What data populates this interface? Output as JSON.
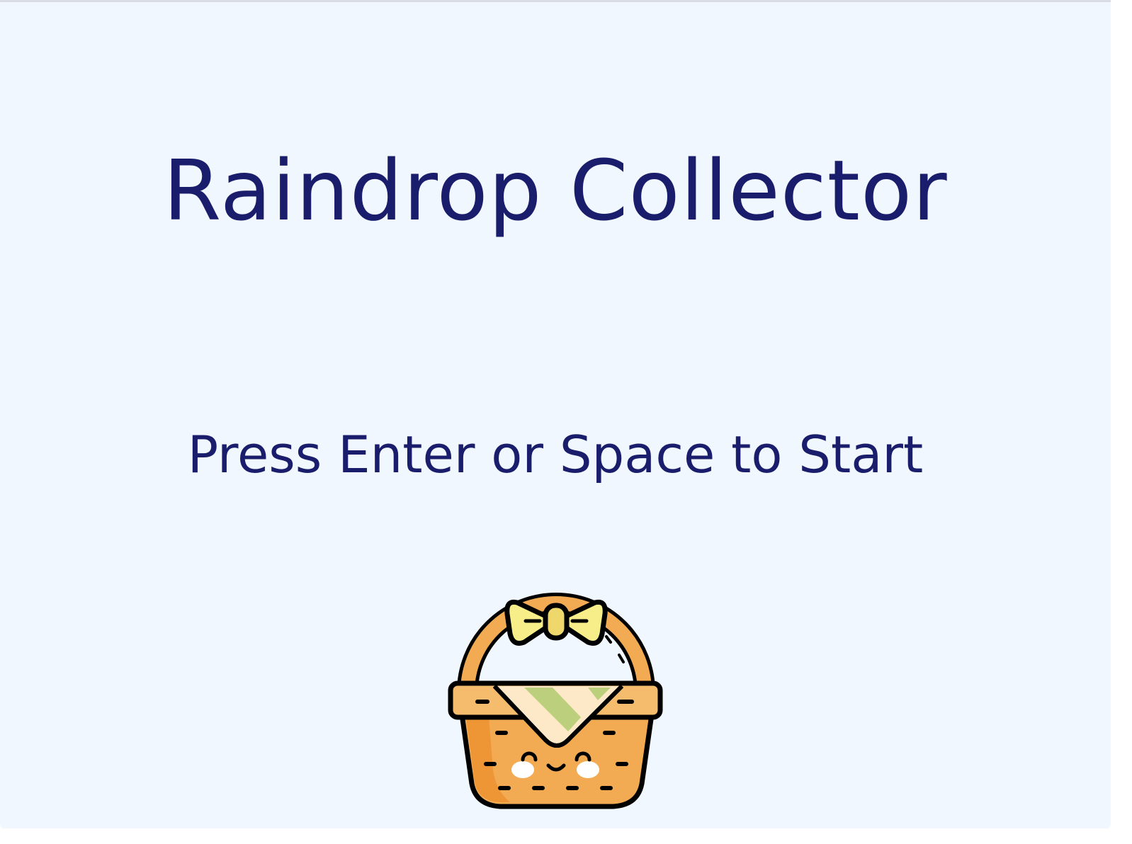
{
  "screen": {
    "title": "Raindrop Collector",
    "start_prompt": "Press Enter or Space to Start"
  },
  "player": {
    "sprite": "basket-icon"
  },
  "colors": {
    "background": "#f1f7fe",
    "text": "#1a1d6b",
    "basket_body": "#f2ab52",
    "basket_shadow": "#ee9636",
    "basket_rim": "#f5bc6e",
    "bow": "#f7ee8a",
    "bow_knot": "#eed86b",
    "cloth_green": "#bccf7c",
    "cloth_cream": "#fde8c7",
    "outline": "#000000"
  }
}
